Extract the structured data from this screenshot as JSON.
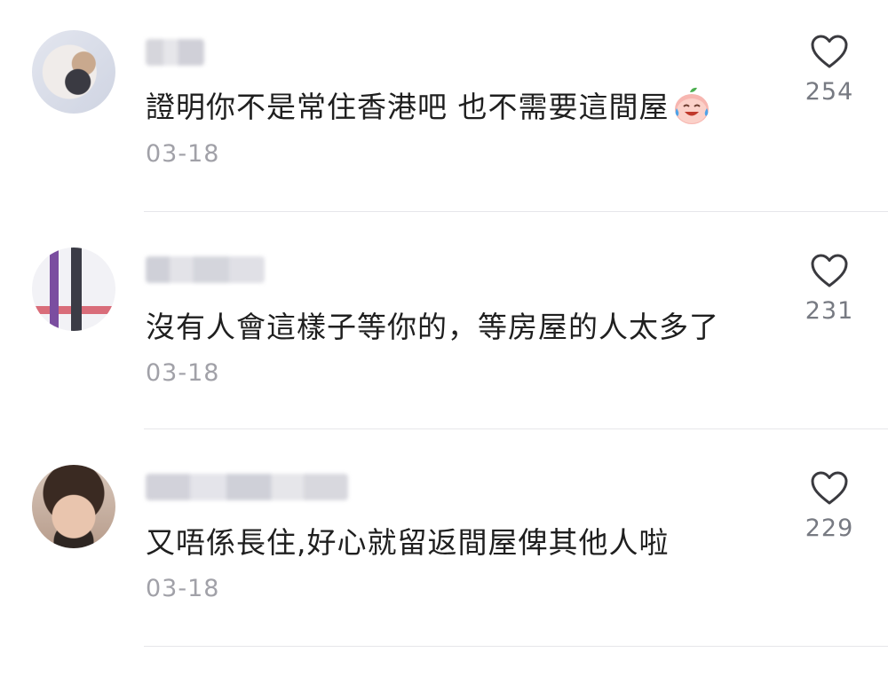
{
  "comments": [
    {
      "username": "",
      "text": "證明你不是常住香港吧 也不需要這間屋",
      "emoji": "crying-laughing-peach-emoji",
      "date": "03-18",
      "likes": "254"
    },
    {
      "username": "",
      "text": "沒有人會這樣子等你的，等房屋的人太多了",
      "date": "03-18",
      "likes": "231"
    },
    {
      "username": "",
      "text": "又唔係長住,好心就留返間屋俾其他人啦",
      "date": "03-18",
      "likes": "229"
    }
  ],
  "icons": {
    "like": "heart-icon"
  },
  "colors": {
    "text": "#1f1f1f",
    "meta": "#a1a1a8",
    "like_count": "#777a82",
    "divider": "#e6e6ea"
  }
}
